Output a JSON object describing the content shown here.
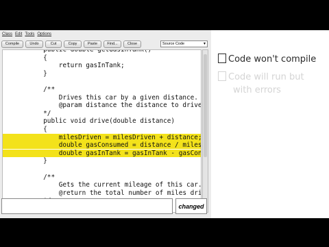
{
  "menu": [
    "Class",
    "Edit",
    "Tools",
    "Options"
  ],
  "toolbar": {
    "buttons": [
      "Compile",
      "Undo",
      "Cut",
      "Copy",
      "Paste",
      "Find...",
      "Close"
    ],
    "view_select": "Source Code"
  },
  "code_lines": [
    {
      "text": "        public double getGasInTank()",
      "highlighted": false
    },
    {
      "text": "        {",
      "highlighted": false
    },
    {
      "text": "            return gasInTank;",
      "highlighted": false
    },
    {
      "text": "        }",
      "highlighted": false
    },
    {
      "text": "",
      "highlighted": false
    },
    {
      "text": "        /**",
      "highlighted": false
    },
    {
      "text": "            Drives this car by a given distance.",
      "highlighted": false
    },
    {
      "text": "            @param distance the distance to drive",
      "highlighted": false
    },
    {
      "text": "        */",
      "highlighted": false
    },
    {
      "text": "        public void drive(double distance)",
      "highlighted": false
    },
    {
      "text": "        {",
      "highlighted": false
    },
    {
      "text": "            milesDriven = milesDriven + distance;",
      "highlighted": true
    },
    {
      "text": "            double gasConsumed = distance / milesPerGallon;",
      "highlighted": true
    },
    {
      "text": "            double gasInTank = gasInTank - gasConsumed;",
      "highlighted": true
    },
    {
      "text": "        }",
      "highlighted": false
    },
    {
      "text": "",
      "highlighted": false
    },
    {
      "text": "        /**",
      "highlighted": false
    },
    {
      "text": "            Gets the current mileage of this car.",
      "highlighted": false
    },
    {
      "text": "            @return the total number of miles driven",
      "highlighted": false
    },
    {
      "text": "        */",
      "highlighted": false
    }
  ],
  "status": {
    "message": "",
    "changed_label": "changed"
  },
  "whiteboard": {
    "option1": "Code won't compile",
    "option2_line1": "Code will run but",
    "option2_line2": "with errors"
  },
  "colors": {
    "highlight": "#f3e21b",
    "ink_active": "#2a2a2a",
    "ink_faded": "#d4d4d4"
  }
}
